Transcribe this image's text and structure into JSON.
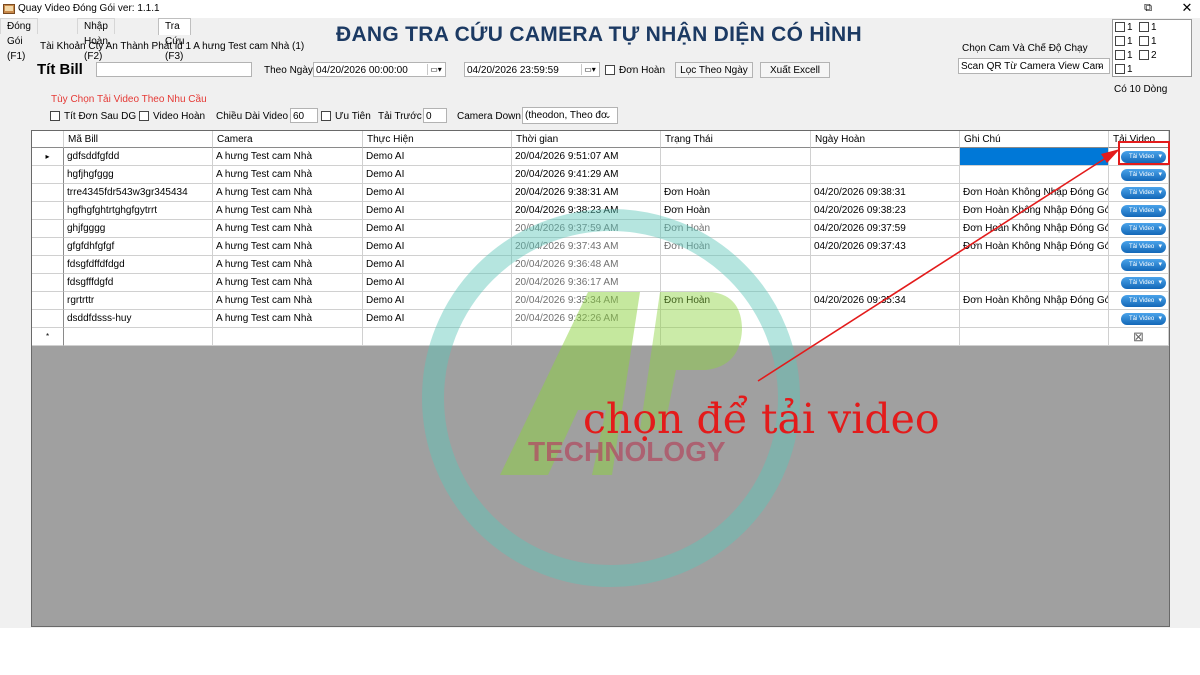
{
  "window": {
    "title": "Quay Video Đóng Gói ver: 1.1.1",
    "restore_glyph": "⧉",
    "close_glyph": "✕"
  },
  "tabs": [
    {
      "label": "Đóng Gói (F1)"
    },
    {
      "label": "Nhập Hoàn (F2)"
    },
    {
      "label": "Tra Cứu (F3)"
    }
  ],
  "header": {
    "account": "Tài Khoản Cty An Thành Phát id 1 A hưng Test cam Nhà (1)",
    "main_title": "ĐANG TRA CỨU CAMERA TỰ NHẬN DIỆN CÓ HÌNH",
    "cam_mode_label": "Chọn Cam Và Chế Độ Chạy",
    "cam_mode_value": "Scan QR Từ Camera View Cam",
    "row_count": "Có 10 Dòng"
  },
  "filters": {
    "tit_bill_label": "Tít Bill",
    "tit_bill_value": "",
    "date_label": "Theo Ngày",
    "date_from": "04/20/2026 00:00:00",
    "date_to": "04/20/2026 23:59:59",
    "don_hoan_label": "Đơn Hoàn",
    "filter_button": "Lọc Theo Ngày",
    "export_button": "Xuất Excell"
  },
  "options": {
    "header": "Tùy Chọn Tải Video Theo Nhu Cầu",
    "tit_don_label": "Tít Đơn Sau DG",
    "video_hoan_label": "Video Hoàn",
    "length_label": "Chiều Dài Video",
    "length_value": "60",
    "priority_label": "Ưu Tiên",
    "before_label": "Tải Trước",
    "before_value": "0",
    "camera_down_label": "Camera Down",
    "camera_down_value": "(theodon, Theo đơ"
  },
  "side_checks": [
    "1",
    "1",
    "1",
    "1",
    "1",
    "2",
    "1"
  ],
  "table": {
    "columns": [
      "Mã Bill",
      "Camera",
      "Thực Hiện",
      "Thời gian",
      "Trạng Thái",
      "Ngày Hoàn",
      "Ghi Chú",
      "Tải Video"
    ],
    "download_label": "Tải Video",
    "current_row_marker": "▸",
    "new_row_marker": "*",
    "rows": [
      {
        "bill": "gdfsddfgfdd",
        "camera": "A hưng Test cam Nhà",
        "by": "Demo AI",
        "time": "20/04/2026 9:51:07 AM",
        "status": "",
        "return_date": "",
        "note": ""
      },
      {
        "bill": "hgfjhgfggg",
        "camera": "A hưng Test cam Nhà",
        "by": "Demo AI",
        "time": "20/04/2026 9:41:29 AM",
        "status": "",
        "return_date": "",
        "note": ""
      },
      {
        "bill": "trre4345fdr543w3gr345434",
        "camera": "A hưng Test cam Nhà",
        "by": "Demo AI",
        "time": "20/04/2026 9:38:31 AM",
        "status": "Đơn Hoàn",
        "return_date": "04/20/2026 09:38:31",
        "note": "Đơn Hoàn Không Nhập Đóng Gó..."
      },
      {
        "bill": "hgfhgfghtrtghgfgytrrt",
        "camera": "A hưng Test cam Nhà",
        "by": "Demo AI",
        "time": "20/04/2026 9:38:23 AM",
        "status": "Đơn Hoàn",
        "return_date": "04/20/2026 09:38:23",
        "note": "Đơn Hoàn Không Nhập Đóng Gó..."
      },
      {
        "bill": "ghjfgggg",
        "camera": "A hưng Test cam Nhà",
        "by": "Demo AI",
        "time": "20/04/2026 9:37:59 AM",
        "status": "Đơn Hoàn",
        "return_date": "04/20/2026 09:37:59",
        "note": "Đơn Hoàn Không Nhập Đóng Gó..."
      },
      {
        "bill": "gfgfdhfgfgf",
        "camera": "A hưng Test cam Nhà",
        "by": "Demo AI",
        "time": "20/04/2026 9:37:43 AM",
        "status": "Đơn Hoàn",
        "return_date": "04/20/2026 09:37:43",
        "note": "Đơn Hoàn Không Nhập Đóng Gó..."
      },
      {
        "bill": "fdsgfdffdfdgd",
        "camera": "A hưng Test cam Nhà",
        "by": "Demo AI",
        "time": "20/04/2026 9:36:48 AM",
        "status": "",
        "return_date": "",
        "note": ""
      },
      {
        "bill": "fdsgfffdgfd",
        "camera": "A hưng Test cam Nhà",
        "by": "Demo AI",
        "time": "20/04/2026 9:36:17 AM",
        "status": "",
        "return_date": "",
        "note": ""
      },
      {
        "bill": "rgrtrttr",
        "camera": "A hưng Test cam Nhà",
        "by": "Demo AI",
        "time": "20/04/2026 9:35:34 AM",
        "status": "Đơn Hoàn",
        "return_date": "04/20/2026 09:35:34",
        "note": "Đơn Hoàn Không Nhập Đóng Gó..."
      },
      {
        "bill": "dsddfdsss-huy",
        "camera": "A hưng Test cam Nhà",
        "by": "Demo AI",
        "time": "20/04/2026 9:32:26 AM",
        "status": "",
        "return_date": "",
        "note": ""
      }
    ]
  },
  "annotation": {
    "text": "chọn để tải video",
    "watermark_letters": "ATP",
    "watermark_text": "TECHNOLOGY"
  },
  "colors": {
    "title_navy": "#1c3a63",
    "selection_blue": "#0078d7",
    "annotation_red": "#e31b1b",
    "watermark_teal": "#5cc5b8",
    "watermark_green": "#8bd23d",
    "download_button_blue": "#1f7fd0"
  },
  "icons": [
    "app-icon",
    "restore-icon",
    "close-icon",
    "calendar-dropdown-icon",
    "chevron-down-icon",
    "row-pointer-icon",
    "delete-icon"
  ]
}
